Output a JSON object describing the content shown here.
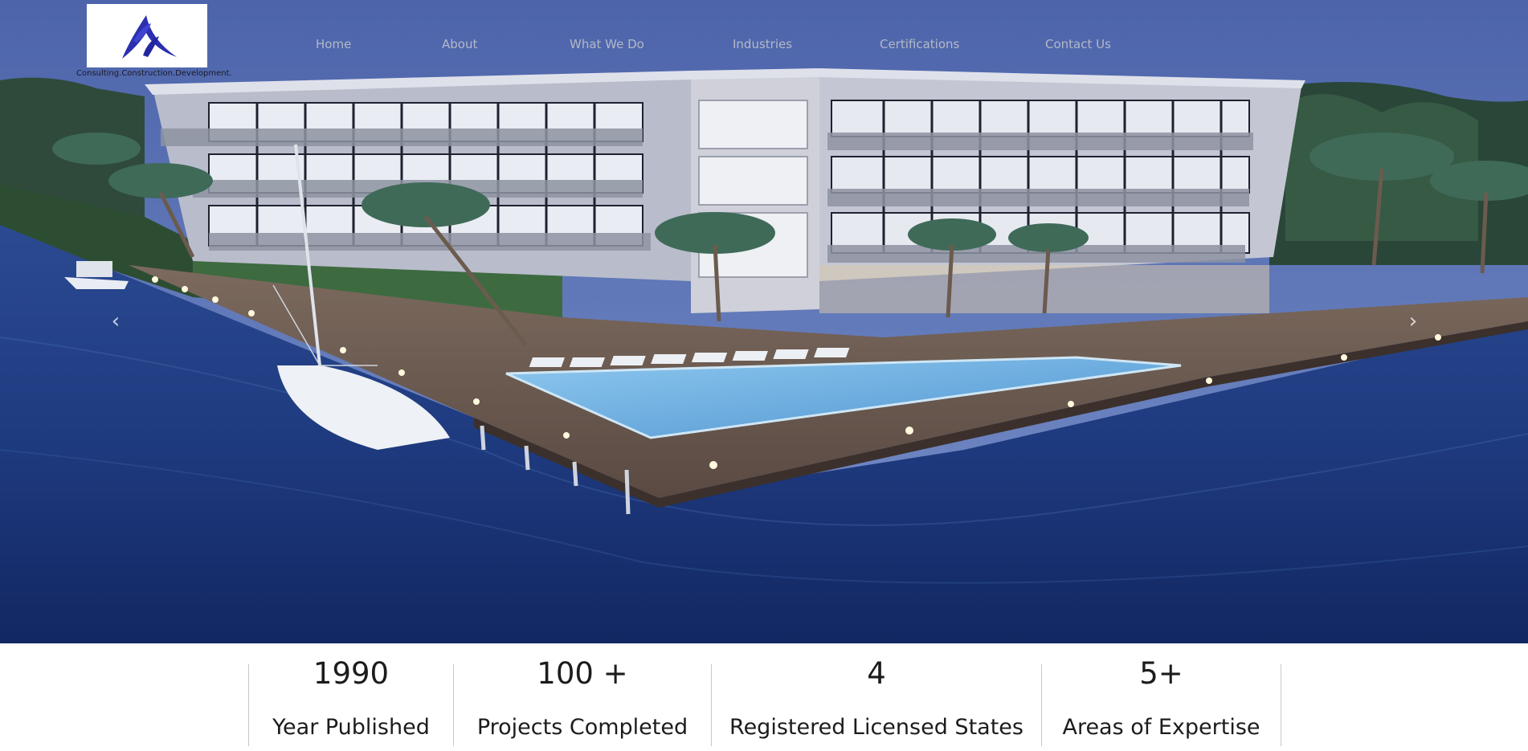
{
  "brand": {
    "logo_name": "company-logo",
    "tagline": "Consulting.Construction.Development."
  },
  "nav": {
    "items": [
      {
        "label": "Home"
      },
      {
        "label": "About"
      },
      {
        "label": "What We Do"
      },
      {
        "label": "Industries"
      },
      {
        "label": "Certifications"
      },
      {
        "label": "Contact Us"
      }
    ]
  },
  "carousel": {
    "prev_icon": "chevron-left-icon",
    "next_icon": "chevron-right-icon",
    "prev_glyph": "‹",
    "next_glyph": "›"
  },
  "stats": [
    {
      "value": "1990",
      "label": "Year Published"
    },
    {
      "value": "100 +",
      "label": "Projects Completed"
    },
    {
      "value": "4",
      "label": "Registered Licensed States"
    },
    {
      "value": "5+",
      "label": "Areas of Expertise"
    }
  ],
  "colors": {
    "nav_text": "#b4b9c6",
    "logo_blue": "#2b2fb0",
    "water": "#1b3778",
    "sky": "#5b73b6"
  }
}
